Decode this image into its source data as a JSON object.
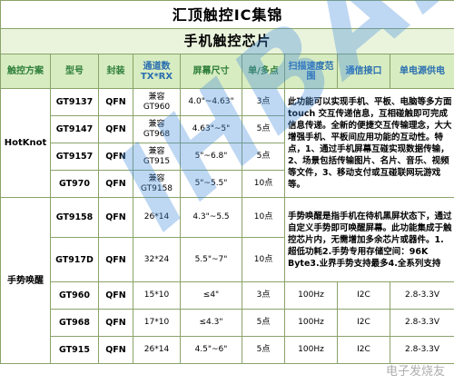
{
  "title": "汇顶触控IC集锦",
  "subtitle": "手机触控芯片",
  "headers": [
    "触控方案",
    "型号",
    "封装",
    "通道数\nTX*RX",
    "屏幕尺寸",
    "单/多点",
    "扫描速度范围",
    "通信接口",
    "单电源供电"
  ],
  "groups": {
    "hotknot": "HotKnot",
    "gesture": "手势唤醒"
  },
  "rows": [
    {
      "model": "GT9137",
      "pkg": "QFN",
      "ch": "兼容\nGT960",
      "size": "4.0\"~4.63\"",
      "pts": "3点"
    },
    {
      "model": "GT9147",
      "pkg": "QFN",
      "ch": "兼容\nGT968",
      "size": "4.63\"~5\"",
      "pts": "5点"
    },
    {
      "model": "GT9157",
      "pkg": "QFN",
      "ch": "兼容\nGT915",
      "size": "5\"~6.8\"",
      "pts": "5点"
    },
    {
      "model": "GT970",
      "pkg": "QFN",
      "ch": "兼容\nGT9158",
      "size": "5\"~5.5\"",
      "pts": "10点"
    },
    {
      "model": "GT9158",
      "pkg": "QFN",
      "ch": "26*14",
      "size": "4.3\"~5.5",
      "pts": "10点"
    },
    {
      "model": "GT917D",
      "pkg": "QFN",
      "ch": "32*24",
      "size": "5.5\"~7\"",
      "pts": "10点"
    },
    {
      "model": "GT960",
      "pkg": "QFN",
      "ch": "15*10",
      "size": "≤4\"",
      "pts": "3点",
      "scan": "100Hz",
      "iface": "I2C",
      "power": "2.8-3.3V"
    },
    {
      "model": "GT968",
      "pkg": "QFN",
      "ch": "17*10",
      "size": "≤4.3\"",
      "pts": "5点",
      "scan": "100Hz",
      "iface": "I2C",
      "power": "2.8-3.3V"
    },
    {
      "model": "GT915",
      "pkg": "QFN",
      "ch": "26*14",
      "size": "4.5\"~6\"",
      "pts": "5点",
      "scan": "100Hz",
      "iface": "I2C",
      "power": "2.8-3.3V"
    }
  ],
  "desc_hotknot": "此功能可以实现手机、平板、电脑等多方面touch 交互传递信息，互相碰触即可完成信息传递。全新的便捷交互传输理念，大大增强手机、平板间应用功能的互动性。特点，1、通过手机屏幕互碰实现数据传输，2、场景包括传输图片、名片、音乐、视频等文件，3、移动支付或互碰联网玩游戏等。",
  "desc_gesture": "手势唤醒是指手机在待机黑屏状态下，通过自定义手势即可唤醒屏幕。此功能集成于触控芯片内，无需增加多余芯片或器件。1.超低功耗2.手势专用存储空间：96K Byte3.业界手势支持最多4.全系列支持",
  "watermark": "IHBAM",
  "logo": "电子发烧友"
}
